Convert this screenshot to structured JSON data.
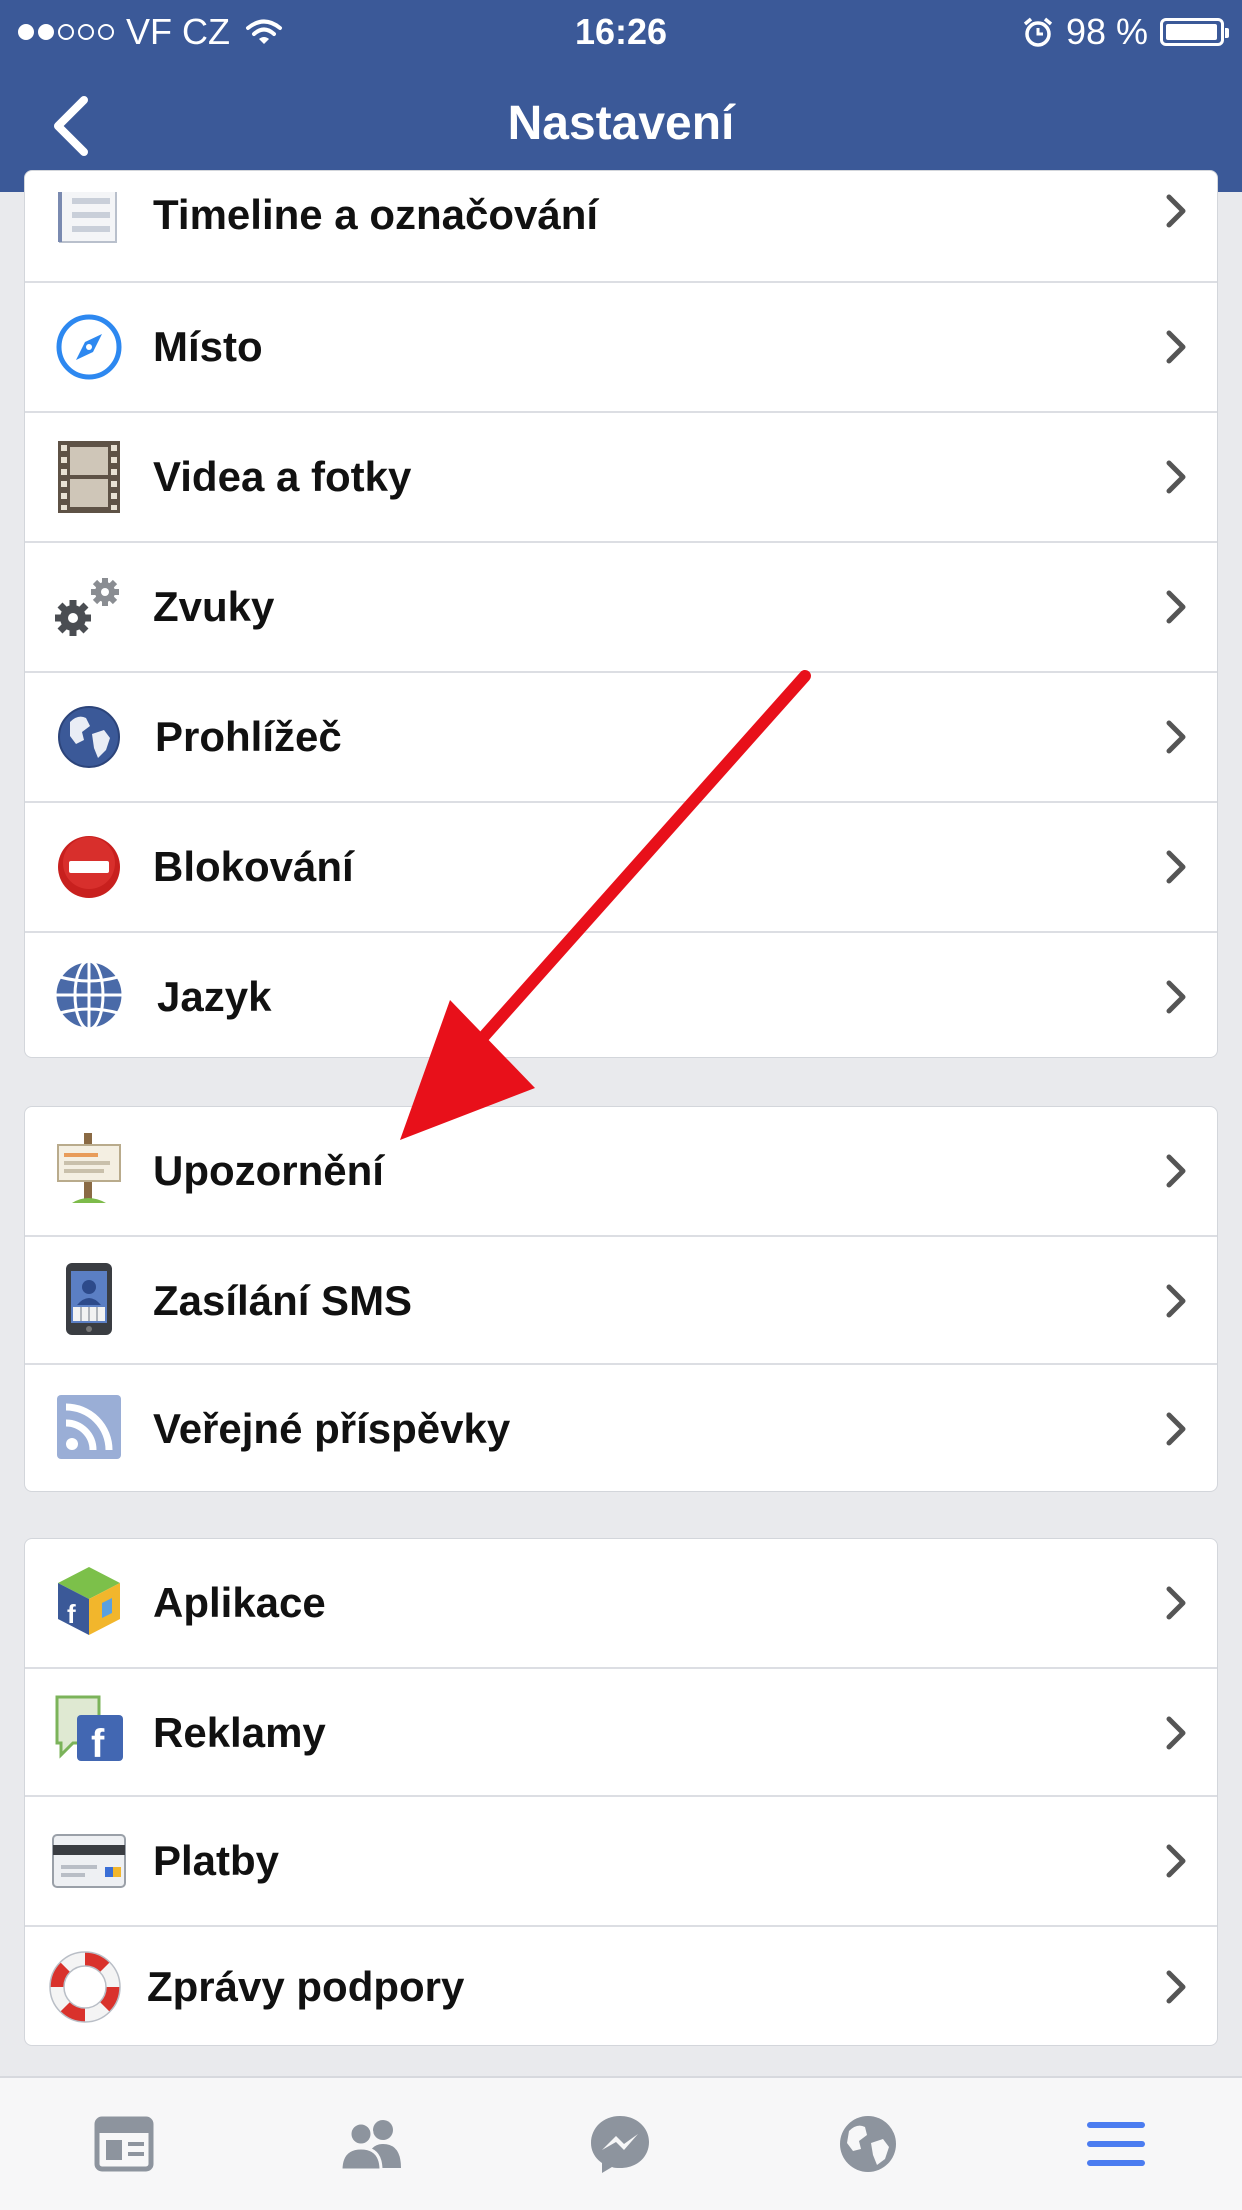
{
  "status_bar": {
    "carrier": "VF CZ",
    "time": "16:26",
    "battery": "98 %",
    "signal_bars_filled": 2,
    "signal_bars_total": 5
  },
  "header": {
    "title": "Nastavení",
    "background": "#3b5998"
  },
  "sections": [
    {
      "items": [
        {
          "label": "Timeline a označování",
          "icon": "timeline-icon"
        },
        {
          "label": "Místo",
          "icon": "compass-icon"
        },
        {
          "label": "Videa a fotky",
          "icon": "film-icon"
        },
        {
          "label": "Zvuky",
          "icon": "gears-icon"
        },
        {
          "label": "Prohlížeč",
          "icon": "globe-browser-icon"
        },
        {
          "label": "Blokování",
          "icon": "block-icon"
        },
        {
          "label": "Jazyk",
          "icon": "language-globe-icon"
        }
      ]
    },
    {
      "items": [
        {
          "label": "Upozornění",
          "icon": "notice-sign-icon"
        },
        {
          "label": "Zasílání SMS",
          "icon": "phone-icon"
        },
        {
          "label": "Veřejné příspěvky",
          "icon": "rss-icon"
        }
      ]
    },
    {
      "items": [
        {
          "label": "Aplikace",
          "icon": "app-cube-icon"
        },
        {
          "label": "Reklamy",
          "icon": "ads-icon"
        },
        {
          "label": "Platby",
          "icon": "credit-card-icon"
        },
        {
          "label": "Zprávy podpory",
          "icon": "lifebuoy-icon"
        }
      ]
    }
  ],
  "tabbar": [
    {
      "name": "news-feed",
      "icon": "news-feed-icon"
    },
    {
      "name": "friends",
      "icon": "friends-icon"
    },
    {
      "name": "messenger",
      "icon": "messenger-icon"
    },
    {
      "name": "notifications",
      "icon": "globe-icon"
    },
    {
      "name": "more",
      "icon": "menu-icon",
      "active": true
    }
  ],
  "colors": {
    "accent": "#3b5998",
    "annotation_arrow": "#e8101a",
    "tab_active": "#4b7cf0",
    "tab_inactive": "#8d949e"
  }
}
